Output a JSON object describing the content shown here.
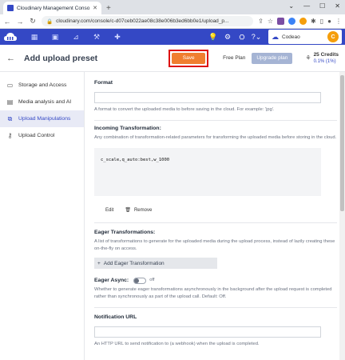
{
  "browser": {
    "tab_title": "Cloudinary Management Conso",
    "url": "cloudinary.com/console/c-d07ceb022ae08c38e006b3ed6bb0e1/upload_p..."
  },
  "account": {
    "name": "Codeao",
    "avatar_letter": "C"
  },
  "header": {
    "title": "Add upload preset",
    "save_label": "Save",
    "free_plan": "Free Plan",
    "upgrade_label": "Upgrade plan",
    "credits": "25 Credits",
    "credits_used": "0.1% (1%)"
  },
  "sidebar": {
    "items": [
      {
        "label": "Storage and Access",
        "icon": "storage-icon"
      },
      {
        "label": "Media analysis and AI",
        "icon": "media-icon"
      },
      {
        "label": "Upload Manipulations",
        "icon": "manipulation-icon",
        "active": true
      },
      {
        "label": "Upload Control",
        "icon": "key-icon"
      }
    ]
  },
  "form": {
    "format": {
      "label": "Format",
      "value": "",
      "desc": "A format to convert the uploaded media to before saving in the cloud. For example: 'jpg'."
    },
    "incoming": {
      "label": "Incoming Transformation:",
      "desc": "Any combination of transformation-related parameters for transforming the uploaded media before storing in the cloud.",
      "value": "c_scale,q_auto:best,w_1000",
      "edit": "Edit",
      "remove": "Remove"
    },
    "eager": {
      "label": "Eager Transformations:",
      "desc": "A list of transformations to generate for the uploaded media during the upload process, instead of lazily creating these on-the-fly on access.",
      "add_label": "Add Eager Transformation"
    },
    "eager_async": {
      "label": "Eager Async:",
      "state": "off",
      "desc": "Whether to generate eager transformations asynchronously in the background after the upload request is completed rather than synchronously as part of the upload call. Default: Off."
    },
    "notification": {
      "label": "Notification URL",
      "value": "",
      "desc": "An HTTP URL to send notification to (a webhook) when the upload is completed."
    }
  }
}
